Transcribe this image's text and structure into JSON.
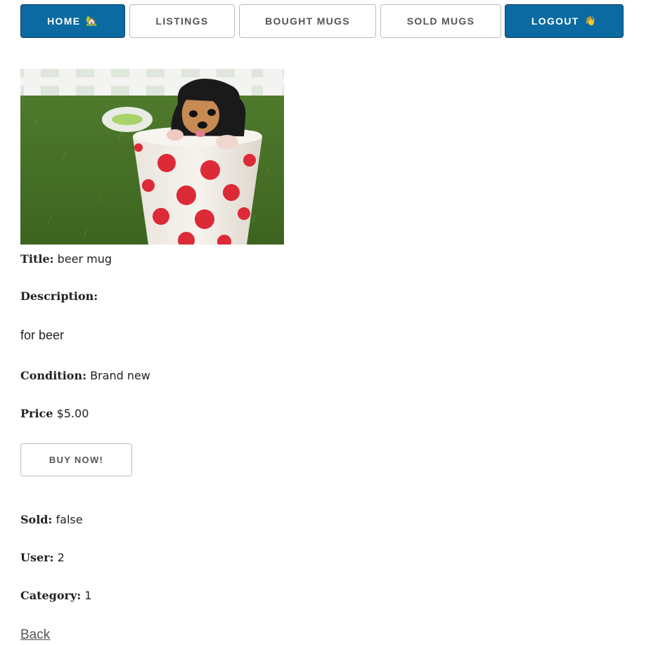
{
  "nav": {
    "home_label": "HOME",
    "home_emoji": "🏡",
    "listings_label": "LISTINGS",
    "bought_label": "BOUGHT MUGS",
    "sold_label": "SOLD MUGS",
    "logout_label": "LOGOUT",
    "logout_emoji": "👋"
  },
  "product": {
    "title_label": "Title:",
    "title": "beer mug",
    "description_label": "Description:",
    "description": "for beer",
    "condition_label": "Condition:",
    "condition": "Brand new",
    "price_label": "Price",
    "price": "$5.00",
    "sold_label": "Sold:",
    "sold": "false",
    "user_label": "User:",
    "user": "2",
    "category_label": "Category:",
    "category": "1"
  },
  "actions": {
    "buy_label": "BUY NOW!",
    "back_label": "Back"
  },
  "colors": {
    "primary": "#0a6aa1",
    "text": "#222222",
    "muted": "#555555"
  }
}
